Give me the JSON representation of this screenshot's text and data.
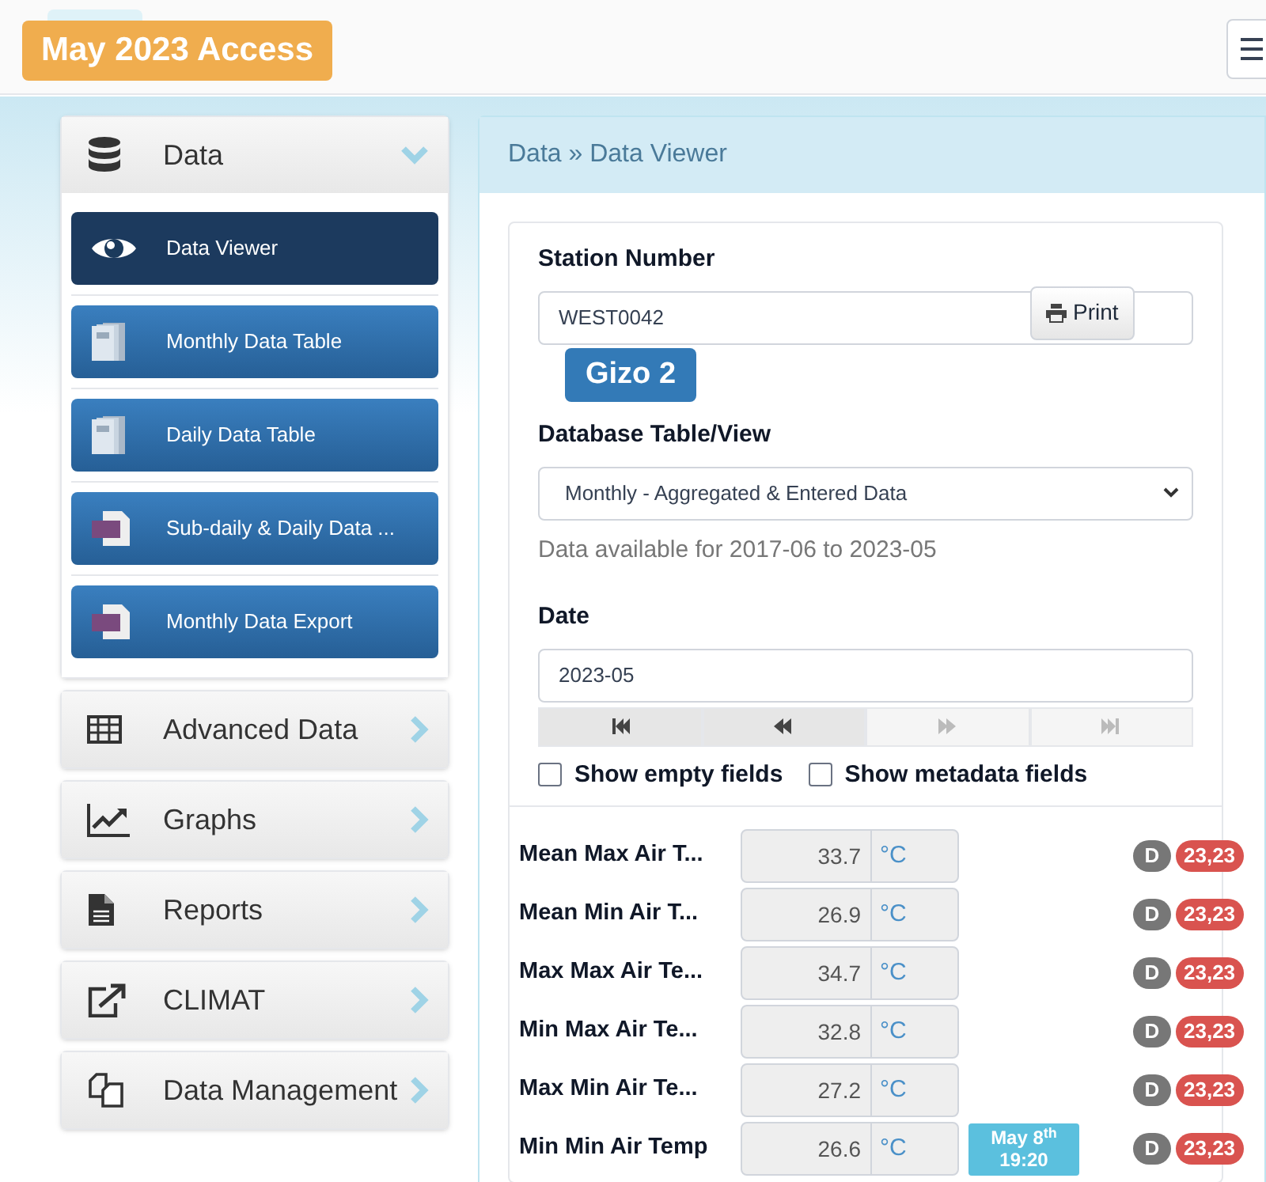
{
  "access_badge": "May 2023 Access",
  "sidebar": {
    "groups": [
      {
        "label": "Data",
        "expanded": true,
        "items": [
          {
            "label": "Data Viewer",
            "selected": true
          },
          {
            "label": "Monthly Data Table",
            "selected": false
          },
          {
            "label": "Daily Data Table",
            "selected": false
          },
          {
            "label": "Sub-daily & Daily Data ...",
            "selected": false
          },
          {
            "label": "Monthly Data Export",
            "selected": false
          }
        ]
      },
      {
        "label": "Advanced Data",
        "expanded": false
      },
      {
        "label": "Graphs",
        "expanded": false
      },
      {
        "label": "Reports",
        "expanded": false
      },
      {
        "label": "CLIMAT",
        "expanded": false
      },
      {
        "label": "Data Management",
        "expanded": false
      }
    ]
  },
  "breadcrumb": "Data » Data Viewer",
  "form": {
    "station_label": "Station Number",
    "station_value": "WEST0042",
    "print_button": "Print",
    "station_name": "Gizo 2",
    "table_label": "Database Table/View",
    "table_value": "Monthly - Aggregated & Entered Data",
    "availability": "Data available for 2017-06 to 2023-05",
    "date_label": "Date",
    "date_value": "2023-05",
    "nav_buttons": [
      {
        "kind": "first",
        "disabled": false
      },
      {
        "kind": "prev",
        "disabled": false
      },
      {
        "kind": "next",
        "disabled": true
      },
      {
        "kind": "last",
        "disabled": true
      }
    ],
    "checkboxes": [
      {
        "label": "Show empty fields",
        "checked": false
      },
      {
        "label": "Show metadata fields",
        "checked": false
      }
    ]
  },
  "rows": [
    {
      "label": "Mean Max Air T...",
      "value": "33.7",
      "unit": "°C",
      "flag": "D",
      "count": "23,23"
    },
    {
      "label": "Mean Min Air T...",
      "value": "26.9",
      "unit": "°C",
      "flag": "D",
      "count": "23,23"
    },
    {
      "label": "Max Max Air Te...",
      "value": "34.7",
      "unit": "°C",
      "flag": "D",
      "count": "23,23"
    },
    {
      "label": "Min Max Air Te...",
      "value": "32.8",
      "unit": "°C",
      "flag": "D",
      "count": "23,23"
    },
    {
      "label": "Max Min Air Te...",
      "value": "27.2",
      "unit": "°C",
      "flag": "D",
      "count": "23,23"
    },
    {
      "label": "Min Min Air Temp",
      "value": "26.6",
      "unit": "°C",
      "date": "May 8$^{th}$",
      "time": "19:20",
      "flag": "D",
      "count": "23,23"
    }
  ]
}
